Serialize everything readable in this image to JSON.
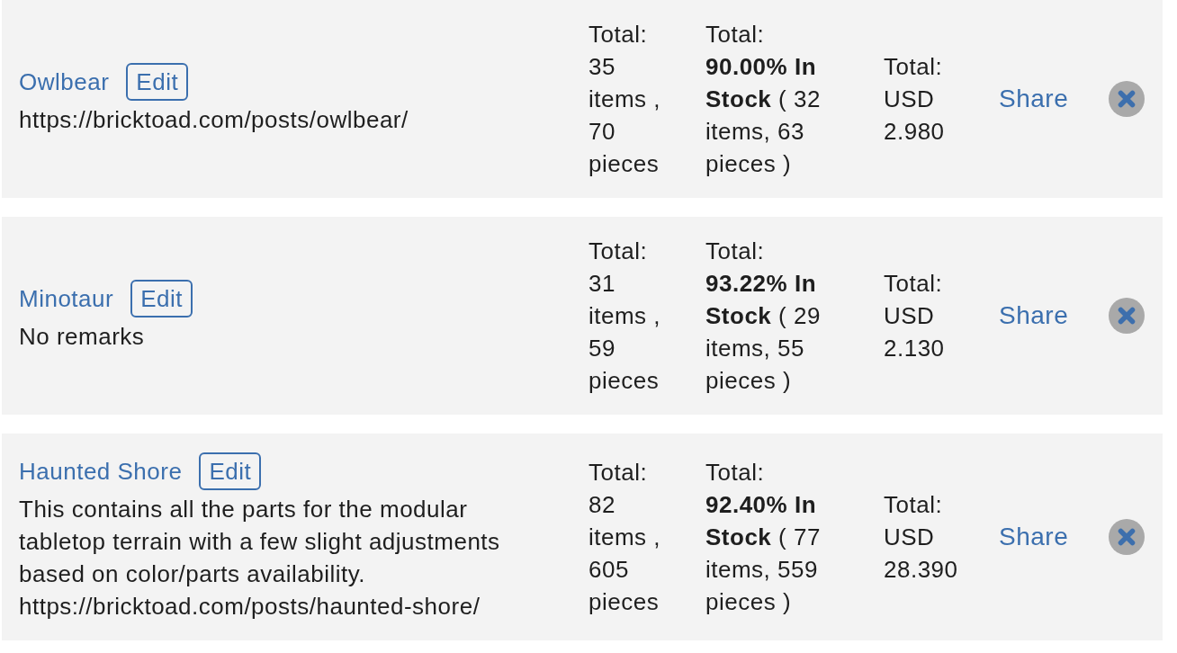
{
  "lists": [
    {
      "name": "Owlbear",
      "edit_label": "Edit",
      "remarks": [
        "https://bricktoad.com/posts/owlbear/"
      ],
      "items_total": {
        "label": "Total:",
        "value": "35 items , 70 pieces"
      },
      "stock_total": {
        "label": "Total:",
        "value": "**90.00% In Stock** ( 32 items, 63 pieces )"
      },
      "price_total": {
        "label": "Total:",
        "value": "USD 2.980"
      },
      "share_label": "Share"
    },
    {
      "name": "Minotaur",
      "edit_label": "Edit",
      "remarks": [
        "No remarks"
      ],
      "items_total": {
        "label": "Total:",
        "value": "31 items , 59 pieces"
      },
      "stock_total": {
        "label": "Total:",
        "value": "**93.22% In Stock** ( 29 items, 55 pieces )"
      },
      "price_total": {
        "label": "Total:",
        "value": "USD 2.130"
      },
      "share_label": "Share"
    },
    {
      "name": "Haunted Shore",
      "edit_label": "Edit",
      "remarks": [
        "This contains all the parts for the modular tabletop terrain with a few slight adjustments based on color/parts availability.",
        "https://bricktoad.com/posts/haunted-shore/"
      ],
      "items_total": {
        "label": "Total:",
        "value": "82 items , 605 pieces"
      },
      "stock_total": {
        "label": "Total:",
        "value": "**92.40% In Stock** ( 77 items, 559 pieces )"
      },
      "price_total": {
        "label": "Total:",
        "value": "USD 28.390"
      },
      "share_label": "Share"
    }
  ]
}
